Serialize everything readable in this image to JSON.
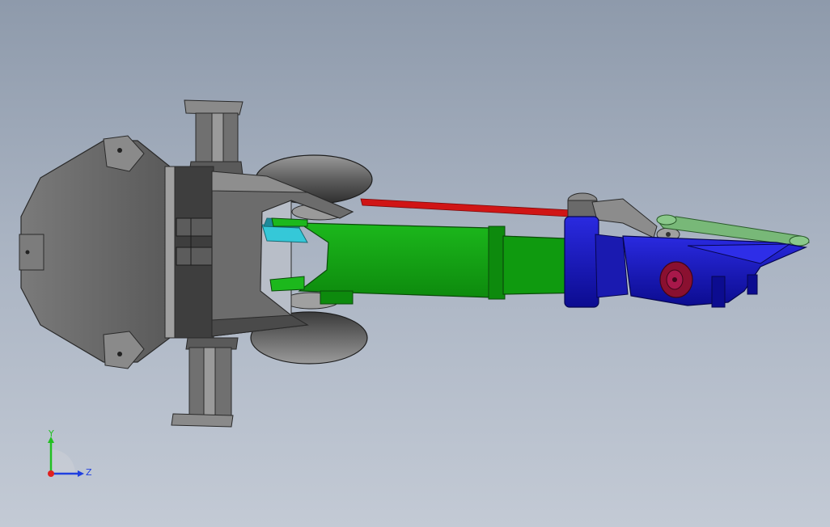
{
  "viewport": {
    "background_top": "#8e9aab",
    "background_bottom": "#c3cad5"
  },
  "model": {
    "colors": {
      "body_gray": "#6f6f6f",
      "body_dark": "#3c3c3c",
      "body_light": "#a3a3a3",
      "boom_green": "#13a113",
      "boom_green_dark": "#0b6e0b",
      "link_blue": "#1414c8",
      "link_blue_dark": "#0a0a80",
      "cable_red": "#d01515",
      "rod_light_green": "#78b878",
      "cyan": "#35c8d8",
      "hub_maroon": "#8a1030"
    }
  },
  "triad": {
    "y_label": "Y",
    "z_label": "Z",
    "colors": {
      "y": "#22c022",
      "z": "#2040e0",
      "x": "#e02020"
    }
  }
}
